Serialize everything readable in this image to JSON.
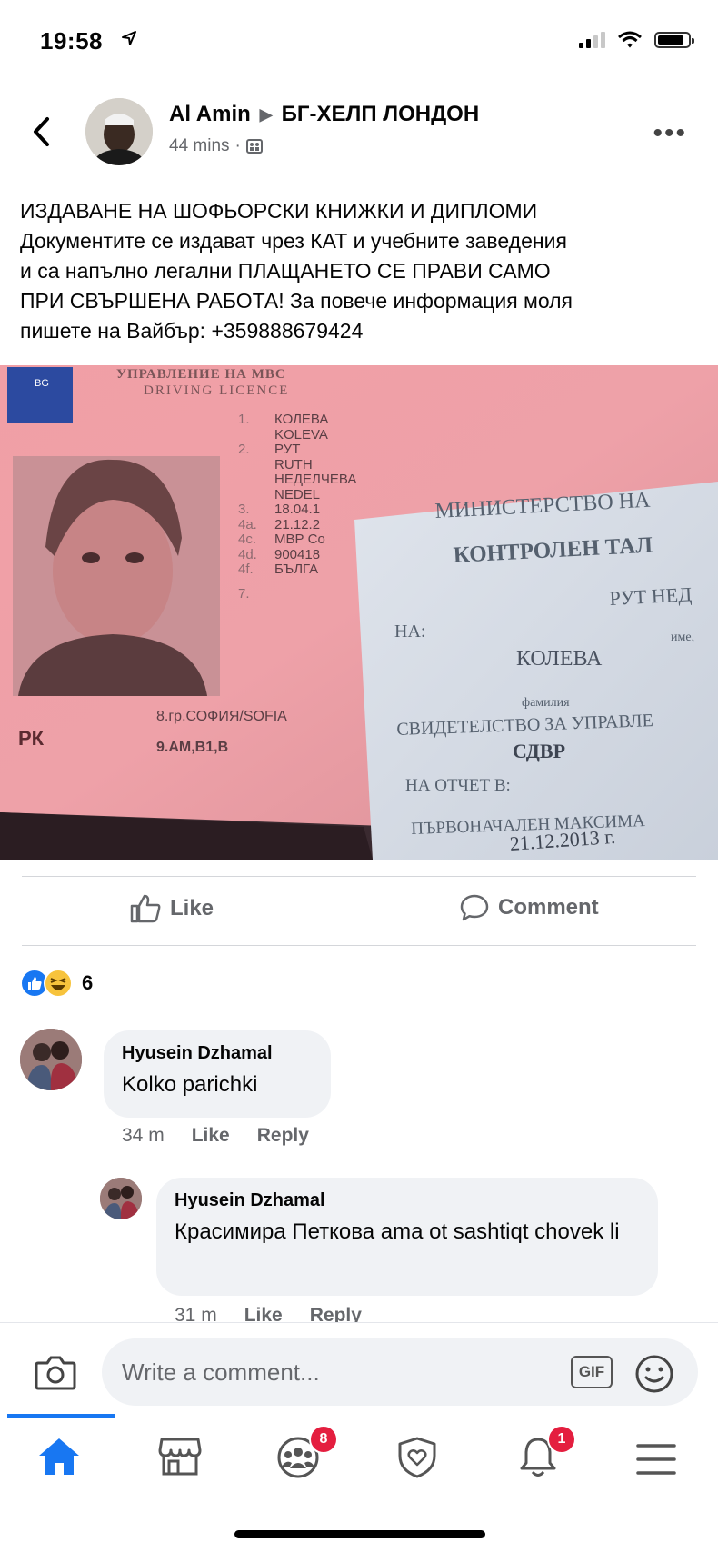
{
  "status_bar": {
    "time": "19:58"
  },
  "post": {
    "author": "Al Amin",
    "group": "БГ-ХЕЛП ЛОНДОН",
    "time": "44 mins",
    "text_lines": [
      "ИЗДАВАНЕ НА ШОФЬОРСКИ КНИЖКИ И ДИПЛОМИ",
      "Документите се издават чрез КАТ и  учебните заведения",
      "и са напълно легални ПЛАЩАНЕТО СЕ ПРАВИ САМО",
      "ПРИ  СВЪРШЕНА РАБОТА! За повече информация моля",
      "пишете на Вайбър:  +359888679424"
    ],
    "photo": {
      "license": {
        "header": "УПРАВЛЕНИЕ НА МВС",
        "subheader": "DRIVING LICENCE",
        "country_code": "BG",
        "fields": [
          {
            "n": "1.",
            "v": "КОЛЕВА"
          },
          {
            "n": "",
            "v": "KOLEVA"
          },
          {
            "n": "2.",
            "v": "РУТ"
          },
          {
            "n": "",
            "v": "RUTH"
          },
          {
            "n": "",
            "v": "НЕДЕЛЧЕВА"
          },
          {
            "n": "",
            "v": "NEDEL"
          },
          {
            "n": "3.",
            "v": "18.04.1"
          },
          {
            "n": "4a.",
            "v": "21.12.2"
          },
          {
            "n": "4c.",
            "v": "МВР Со"
          },
          {
            "n": "4d.",
            "v": "900418"
          },
          {
            "n": "4f.",
            "v": "БЪЛГА"
          },
          {
            "n": "7.",
            "v": ""
          }
        ],
        "place": "8.гр.СОФИЯ/SOFIA",
        "categories": "9.AM,B1,B",
        "mark": "РК"
      },
      "coupon": {
        "title": "МИНИСТЕРСТВО НА",
        "heading": "КОНТРОЛЕН ТАЛ",
        "name_first": "РУТ НЕД",
        "na_label": "НА:",
        "ime_label": "име,",
        "surname": "КОЛЕВА",
        "familiya_label": "фамилия",
        "svid": "СВИДЕТЕЛСТВО ЗА УПРАВЛЕ",
        "sdvr": "СДВР",
        "otchet": "НА ОТЧЕТ В:",
        "parvonach": "ПЪРВОНАЧАЛЕН МАКСИМА",
        "date": "21.12.2013 г."
      }
    },
    "actions": {
      "like": "Like",
      "comment": "Comment"
    },
    "reaction_count": "6"
  },
  "comments": [
    {
      "name": "Hyusein Dzhamal",
      "text": "Kolko parichki",
      "time": "34 m",
      "like": "Like",
      "reply": "Reply"
    },
    {
      "name": "Hyusein Dzhamal",
      "text": "Красимира Петкова ama ot sashtiqt chovek li",
      "time": "31 m",
      "like": "Like",
      "reply": "Reply"
    }
  ],
  "composer": {
    "placeholder": "Write a comment...",
    "gif": "GIF"
  },
  "nav": {
    "groups_badge": "8",
    "notifications_badge": "1"
  }
}
